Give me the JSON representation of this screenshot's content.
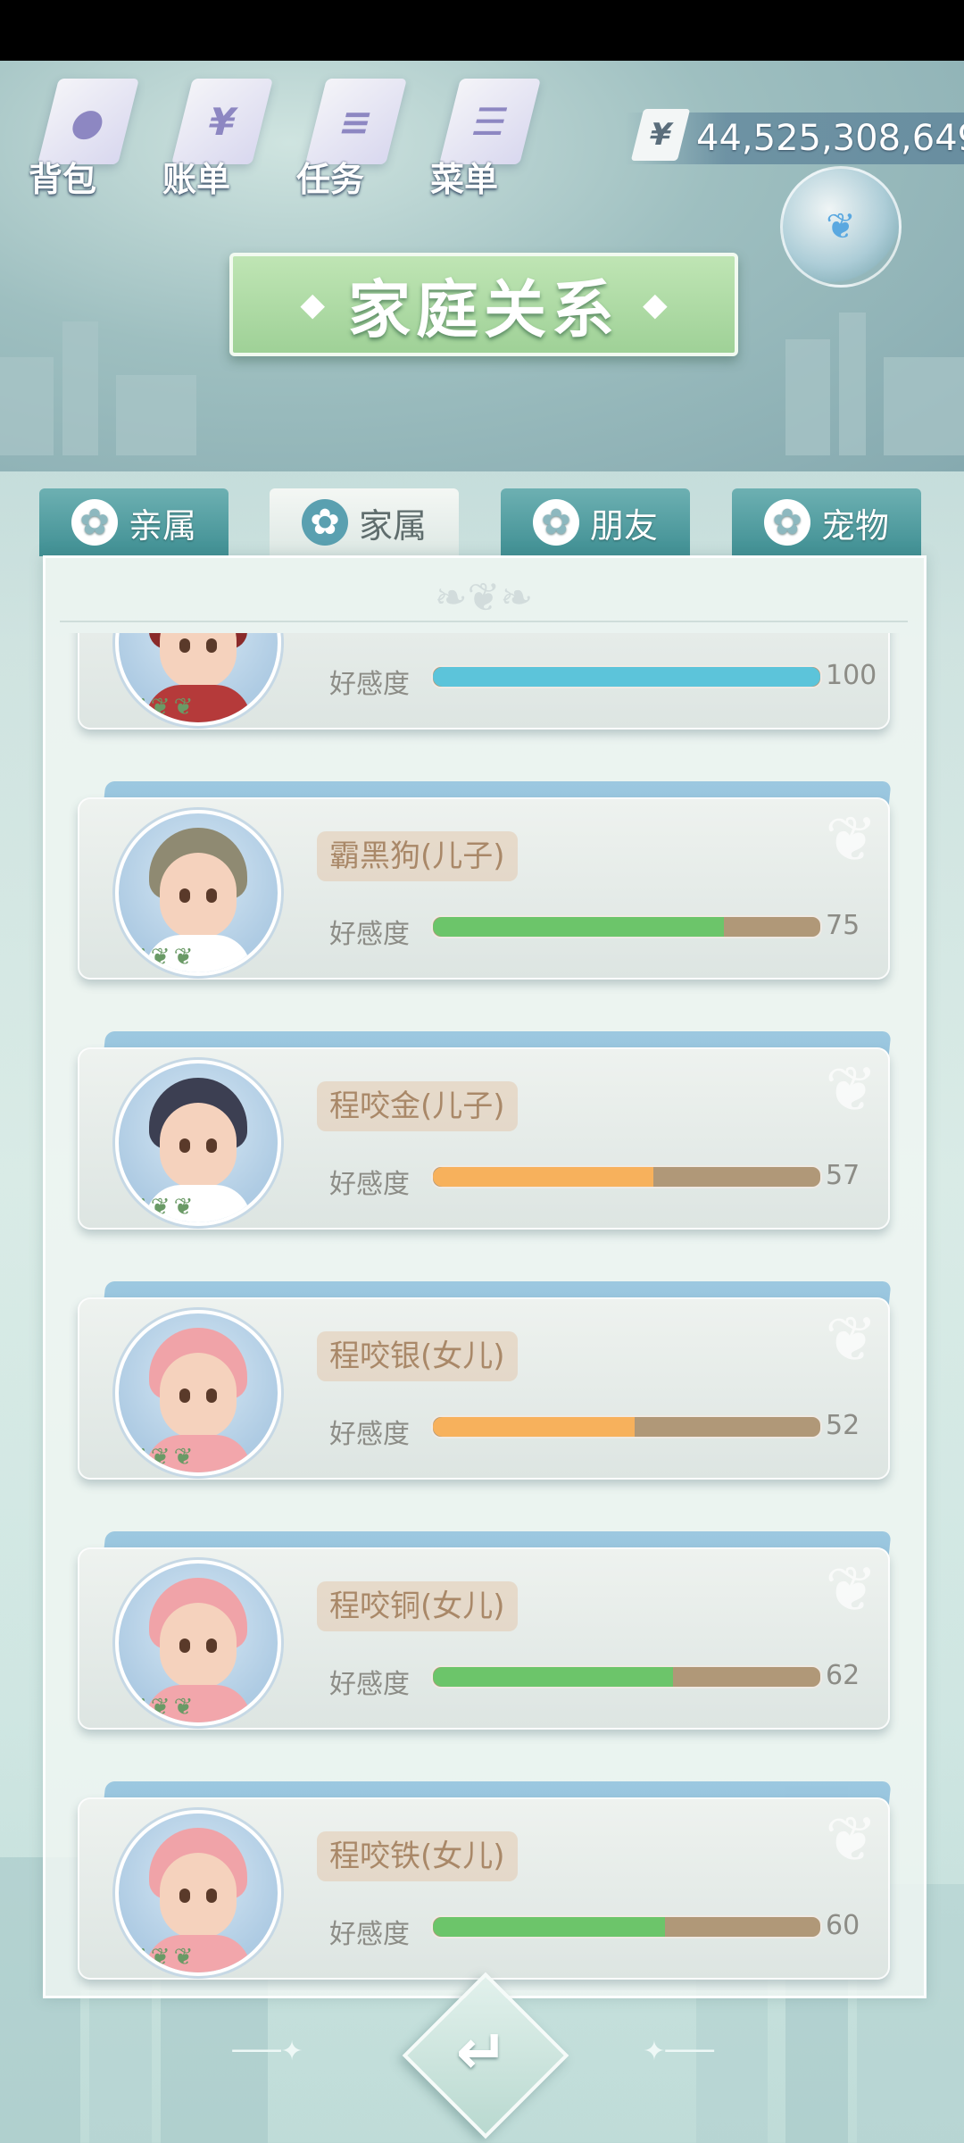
{
  "top_menu": [
    {
      "label": "背包",
      "icon": "bag-icon",
      "glyph": "●"
    },
    {
      "label": "账单",
      "icon": "bill-icon",
      "glyph": "¥"
    },
    {
      "label": "任务",
      "icon": "task-icon",
      "glyph": "≡"
    },
    {
      "label": "菜单",
      "icon": "menu-icon",
      "glyph": "☰"
    }
  ],
  "currency": {
    "symbol": "¥",
    "amount": "44,525,308,649"
  },
  "title": "家庭关系",
  "tabs": [
    {
      "label": "亲属",
      "active": false
    },
    {
      "label": "家属",
      "active": true
    },
    {
      "label": "朋友",
      "active": false
    },
    {
      "label": "宠物",
      "active": false
    }
  ],
  "affinity_label": "好感度",
  "members": [
    {
      "name": "",
      "affinity": 100,
      "color": "#5cc4da",
      "hair": "#8a2a2a",
      "shirt": "#b53a3a"
    },
    {
      "name": "霸黑狗(儿子)",
      "affinity": 75,
      "color": "#6cc56a",
      "hair": "#8f8a72",
      "shirt": "#ffffff"
    },
    {
      "name": "程咬金(儿子)",
      "affinity": 57,
      "color": "#f7b15c",
      "hair": "#3c3f52",
      "shirt": "#ffffff"
    },
    {
      "name": "程咬银(女儿)",
      "affinity": 52,
      "color": "#f7b15c",
      "hair": "#f0a3a8",
      "shirt": "#f2a6ab"
    },
    {
      "name": "程咬铜(女儿)",
      "affinity": 62,
      "color": "#6cc56a",
      "hair": "#f0a3a8",
      "shirt": "#f2a6ab"
    },
    {
      "name": "程咬铁(女儿)",
      "affinity": 60,
      "color": "#6cc56a",
      "hair": "#f0a3a8",
      "shirt": "#f2a6ab"
    }
  ],
  "back_icon": "back-arrow-icon",
  "back_glyph": "↵"
}
